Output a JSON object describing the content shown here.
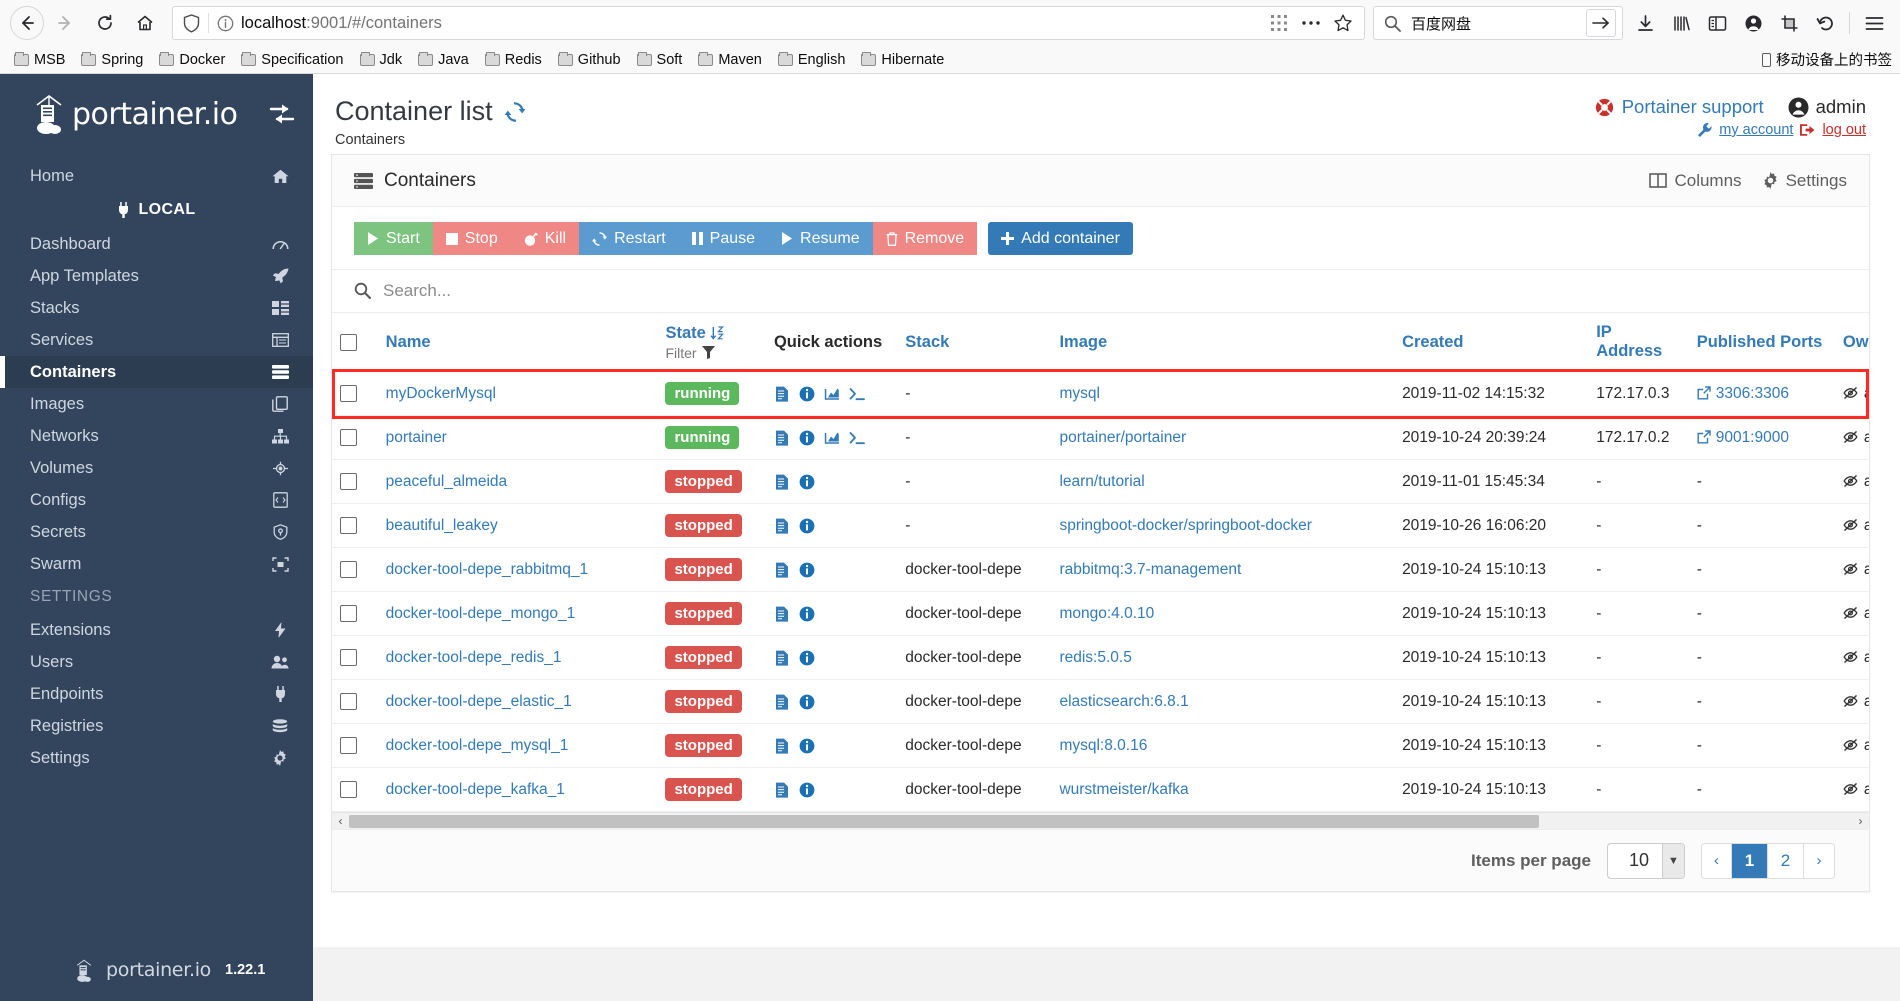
{
  "browser": {
    "url_host": "localhost",
    "url_rest": ":9001/#/containers",
    "search_query": "百度网盘",
    "bookmarks": [
      "MSB",
      "Spring",
      "Docker",
      "Specification",
      "Jdk",
      "Java",
      "Redis",
      "Github",
      "Soft",
      "Maven",
      "English",
      "Hibernate"
    ],
    "mobile_bookmarks_label": "移动设备上的书签"
  },
  "sidebar": {
    "brand": "portainer.io",
    "endpoint_label": "LOCAL",
    "items": [
      {
        "label": "Home",
        "icon": "home-icon",
        "active": false
      },
      {
        "label": "Dashboard",
        "icon": "dashboard-icon",
        "active": false
      },
      {
        "label": "App Templates",
        "icon": "rocket-icon",
        "active": false
      },
      {
        "label": "Stacks",
        "icon": "stacks-icon",
        "active": false
      },
      {
        "label": "Services",
        "icon": "services-icon",
        "active": false
      },
      {
        "label": "Containers",
        "icon": "containers-icon",
        "active": true
      },
      {
        "label": "Images",
        "icon": "images-icon",
        "active": false
      },
      {
        "label": "Networks",
        "icon": "networks-icon",
        "active": false
      },
      {
        "label": "Volumes",
        "icon": "volumes-icon",
        "active": false
      },
      {
        "label": "Configs",
        "icon": "configs-icon",
        "active": false
      },
      {
        "label": "Secrets",
        "icon": "secrets-icon",
        "active": false
      },
      {
        "label": "Swarm",
        "icon": "swarm-icon",
        "active": false
      }
    ],
    "settings_section": "SETTINGS",
    "settings_items": [
      {
        "label": "Extensions",
        "icon": "bolt-icon"
      },
      {
        "label": "Users",
        "icon": "users-icon"
      },
      {
        "label": "Endpoints",
        "icon": "plug-icon"
      },
      {
        "label": "Registries",
        "icon": "database-icon"
      },
      {
        "label": "Settings",
        "icon": "gear-icon"
      }
    ],
    "footer_brand": "portainer.io",
    "version": "1.22.1"
  },
  "header": {
    "title": "Container list",
    "breadcrumb": "Containers",
    "support_label": "Portainer support",
    "user_name": "admin",
    "my_account_label": "my account",
    "log_out_label": "log out"
  },
  "panel": {
    "title": "Containers",
    "columns_label": "Columns",
    "settings_label": "Settings",
    "buttons": [
      {
        "label": "Start",
        "icon": "play-icon",
        "style": "green"
      },
      {
        "label": "Stop",
        "icon": "stop-icon",
        "style": "red"
      },
      {
        "label": "Kill",
        "icon": "bomb-icon",
        "style": "red"
      },
      {
        "label": "Restart",
        "icon": "restart-icon",
        "style": "blue"
      },
      {
        "label": "Pause",
        "icon": "pause-icon",
        "style": "blue"
      },
      {
        "label": "Resume",
        "icon": "play-icon",
        "style": "blue"
      },
      {
        "label": "Remove",
        "icon": "trash-icon",
        "style": "red"
      }
    ],
    "add_container_label": "Add container",
    "search_placeholder": "Search..."
  },
  "table": {
    "headers": {
      "name": "Name",
      "state": "State",
      "filter": "Filter",
      "quick_actions": "Quick actions",
      "stack": "Stack",
      "image": "Image",
      "created": "Created",
      "ip_address": "IP Address",
      "published_ports": "Published Ports",
      "ownership": "Ownershi"
    },
    "rows": [
      {
        "name": "myDockerMysql",
        "state": "running",
        "quick_actions": [
          "logs-icon",
          "inspect-icon",
          "stats-icon",
          "console-icon"
        ],
        "stack": "-",
        "image": "mysql",
        "created": "2019-11-02 14:15:32",
        "ip": "172.17.0.3",
        "ports": "3306:3306",
        "ownership": "adminis",
        "highlight": true
      },
      {
        "name": "portainer",
        "state": "running",
        "quick_actions": [
          "logs-icon",
          "inspect-icon",
          "stats-icon",
          "console-icon"
        ],
        "stack": "-",
        "image": "portainer/portainer",
        "created": "2019-10-24 20:39:24",
        "ip": "172.17.0.2",
        "ports": "9001:9000",
        "ownership": "adminis",
        "highlight": false
      },
      {
        "name": "peaceful_almeida",
        "state": "stopped",
        "quick_actions": [
          "logs-icon",
          "inspect-icon"
        ],
        "stack": "-",
        "image": "learn/tutorial",
        "created": "2019-11-01 15:45:34",
        "ip": "-",
        "ports": "-",
        "ownership": "adminis",
        "highlight": false
      },
      {
        "name": "beautiful_leakey",
        "state": "stopped",
        "quick_actions": [
          "logs-icon",
          "inspect-icon"
        ],
        "stack": "-",
        "image": "springboot-docker/springboot-docker",
        "created": "2019-10-26 16:06:20",
        "ip": "-",
        "ports": "-",
        "ownership": "adminis",
        "highlight": false
      },
      {
        "name": "docker-tool-depe_rabbitmq_1",
        "state": "stopped",
        "quick_actions": [
          "logs-icon",
          "inspect-icon"
        ],
        "stack": "docker-tool-depe",
        "image": "rabbitmq:3.7-management",
        "created": "2019-10-24 15:10:13",
        "ip": "-",
        "ports": "-",
        "ownership": "adminis",
        "highlight": false
      },
      {
        "name": "docker-tool-depe_mongo_1",
        "state": "stopped",
        "quick_actions": [
          "logs-icon",
          "inspect-icon"
        ],
        "stack": "docker-tool-depe",
        "image": "mongo:4.0.10",
        "created": "2019-10-24 15:10:13",
        "ip": "-",
        "ports": "-",
        "ownership": "adminis",
        "highlight": false
      },
      {
        "name": "docker-tool-depe_redis_1",
        "state": "stopped",
        "quick_actions": [
          "logs-icon",
          "inspect-icon"
        ],
        "stack": "docker-tool-depe",
        "image": "redis:5.0.5",
        "created": "2019-10-24 15:10:13",
        "ip": "-",
        "ports": "-",
        "ownership": "adminis",
        "highlight": false
      },
      {
        "name": "docker-tool-depe_elastic_1",
        "state": "stopped",
        "quick_actions": [
          "logs-icon",
          "inspect-icon"
        ],
        "stack": "docker-tool-depe",
        "image": "elasticsearch:6.8.1",
        "created": "2019-10-24 15:10:13",
        "ip": "-",
        "ports": "-",
        "ownership": "adminis",
        "highlight": false
      },
      {
        "name": "docker-tool-depe_mysql_1",
        "state": "stopped",
        "quick_actions": [
          "logs-icon",
          "inspect-icon"
        ],
        "stack": "docker-tool-depe",
        "image": "mysql:8.0.16",
        "created": "2019-10-24 15:10:13",
        "ip": "-",
        "ports": "-",
        "ownership": "adminis",
        "highlight": false
      },
      {
        "name": "docker-tool-depe_kafka_1",
        "state": "stopped",
        "quick_actions": [
          "logs-icon",
          "inspect-icon"
        ],
        "stack": "docker-tool-depe",
        "image": "wurstmeister/kafka",
        "created": "2019-10-24 15:10:13",
        "ip": "-",
        "ports": "-",
        "ownership": "adminis",
        "highlight": false
      }
    ]
  },
  "pagination": {
    "items_per_page_label": "Items per page",
    "items_per_page_value": "10",
    "prev": "‹",
    "pages": [
      "1",
      "2"
    ],
    "active_page": "1",
    "next": "›"
  },
  "colors": {
    "sidebar_bg": "#33455c",
    "accent": "#337ab7",
    "running": "#5cb85c",
    "stopped": "#d9534f",
    "highlight": "#ff2a22"
  }
}
